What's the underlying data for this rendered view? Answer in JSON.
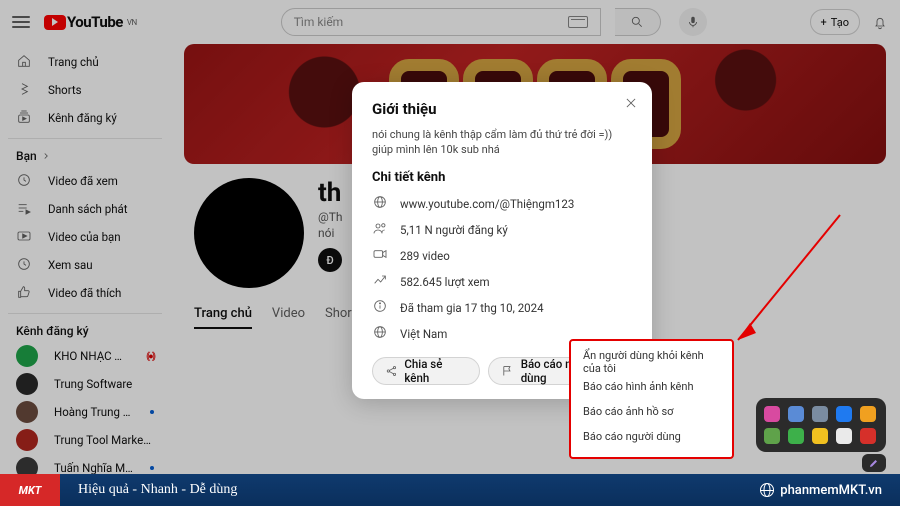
{
  "topbar": {
    "logo_text": "YouTube",
    "region": "VN",
    "search_placeholder": "Tìm kiếm",
    "create_label": "Tạo"
  },
  "sidebar": {
    "primary": [
      {
        "icon": "home",
        "label": "Trang chủ"
      },
      {
        "icon": "shorts",
        "label": "Shorts"
      },
      {
        "icon": "subs",
        "label": "Kênh đăng ký"
      }
    ],
    "you_title": "Bạn",
    "you": [
      {
        "icon": "history",
        "label": "Video đã xem"
      },
      {
        "icon": "playlist",
        "label": "Danh sách phát"
      },
      {
        "icon": "yourvideos",
        "label": "Video của bạn"
      },
      {
        "icon": "later",
        "label": "Xem sau"
      },
      {
        "icon": "liked",
        "label": "Video đã thích"
      }
    ],
    "subs_title": "Kênh đăng ký",
    "subs": [
      {
        "label": "KHO NHẠC TRỮ ...",
        "color": "#1fa54a",
        "live": true
      },
      {
        "label": "Trung Software",
        "color": "#2a2a2a"
      },
      {
        "label": "Hoàng Trung Ki...",
        "color": "#6b4b3e",
        "dot": true
      },
      {
        "label": "Trung Tool Marketi...",
        "color": "#b0271f"
      },
      {
        "label": "Tuấn Nghĩa Marketi...",
        "color": "#3a3a3a",
        "dot": true
      }
    ]
  },
  "channel": {
    "name_partial": "th",
    "handle_partial": "@Th",
    "desc_partial": "nói",
    "sub_btn_partial": "Đ",
    "tabs": [
      "Trang chủ",
      "Video",
      "Shor"
    ]
  },
  "modal": {
    "title": "Giới thiệu",
    "description_l1": "nói chung là kênh thập cẩm làm đủ thứ trẻ đời =))",
    "description_l2": "giúp mình lên 10k sub nhá",
    "details_title": "Chi tiết kênh",
    "details": [
      {
        "icon": "globe",
        "text": "www.youtube.com/@Thiệngm123"
      },
      {
        "icon": "people",
        "text": "5,11 N người đăng ký"
      },
      {
        "icon": "video",
        "text": "289 video"
      },
      {
        "icon": "trend",
        "text": "582.645 lượt xem"
      },
      {
        "icon": "info",
        "text": "Đã tham gia 17 thg 10, 2024"
      },
      {
        "icon": "globe",
        "text": "Việt Nam"
      }
    ],
    "share_label": "Chia sẻ kênh",
    "report_label": "Báo cáo người dùng"
  },
  "context_menu": [
    "Ẩn người dùng khỏi kênh của tôi",
    "Báo cáo hình ảnh kênh",
    "Báo cáo ảnh hồ sơ",
    "Báo cáo người dùng"
  ],
  "footer": {
    "brand": "MKT",
    "slogan": "Hiệu quả - Nhanh - Dễ dùng",
    "site": "phanmemMKT.vn"
  },
  "tray_colors": [
    "#d84aa0",
    "#5a8bd6",
    "#7a8ca1",
    "#1f7af0",
    "#f0a020",
    "#5fa24a",
    "#3db04a",
    "#f0c020",
    "#eaeaea",
    "#d6302a"
  ]
}
